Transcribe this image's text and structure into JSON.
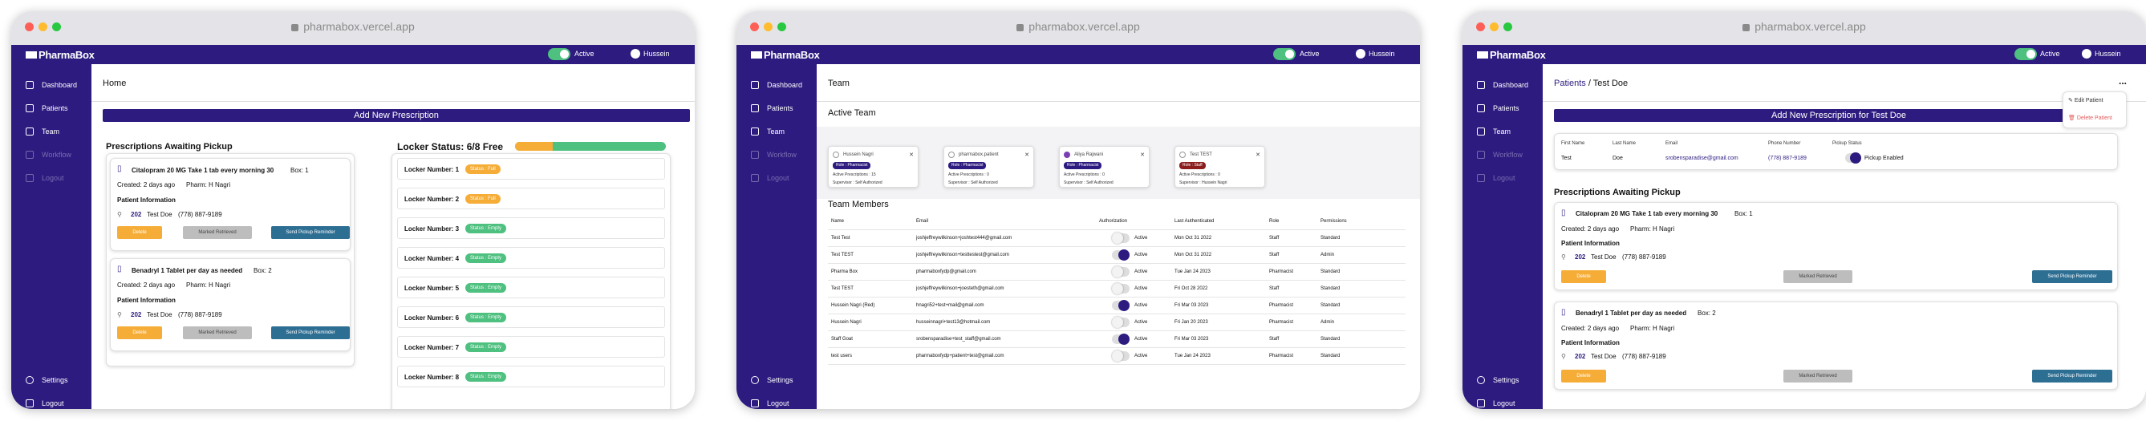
{
  "colors": {
    "brand": "#2d1b80",
    "active": "#4ec07f",
    "warning": "#f6ad37",
    "danger": "#e35d5d",
    "muted": "#bdbdbd",
    "teal": "#2d6e93"
  },
  "common": {
    "url": "pharmabox.vercel.app",
    "brand": "PharmaBox",
    "status_label": "Active",
    "user_name": "Hussein",
    "nav": {
      "dashboard": "Dashboard",
      "patients": "Patients",
      "team": "Team",
      "workflow": "Workflow",
      "logout": "Logout",
      "settings": "Settings"
    }
  },
  "home": {
    "breadcrumb": "Home",
    "add_button": "Add New Prescription",
    "awaiting_title": "Prescriptions Awaiting Pickup",
    "prescriptions": [
      {
        "med": "Citalopram 20 MG Take 1 tab every morning 30",
        "box": "Box: 1",
        "created": "Created: 2 days ago",
        "pharm": "Pharm: H Nagri",
        "info": "Patient Information",
        "room": "202",
        "patient": "Test Doe",
        "phone": "(778) 887-9189",
        "delete": "Delete",
        "retrieved": "Marked Retrieved",
        "reminder": "Send Pickup Reminder"
      },
      {
        "med": "Benadryl 1 Tablet per day as needed",
        "box": "Box: 2",
        "created": "Created: 2 days ago",
        "pharm": "Pharm: H Nagri",
        "info": "Patient Information",
        "room": "202",
        "patient": "Test Doe",
        "phone": "(778) 887-9189",
        "delete": "Delete",
        "retrieved": "Marked Retrieved",
        "reminder": "Send Pickup Reminder"
      }
    ],
    "locker_title": "Locker Status: 6/8 Free",
    "locker_fill": {
      "used": 0.25,
      "free": 0.75
    },
    "lockers": [
      {
        "label": "Locker Number: 1",
        "status": "Status : Full",
        "state": "full"
      },
      {
        "label": "Locker Number: 2",
        "status": "Status : Full",
        "state": "full"
      },
      {
        "label": "Locker Number: 3",
        "status": "Status : Empty",
        "state": "empty"
      },
      {
        "label": "Locker Number: 4",
        "status": "Status : Empty",
        "state": "empty"
      },
      {
        "label": "Locker Number: 5",
        "status": "Status : Empty",
        "state": "empty"
      },
      {
        "label": "Locker Number: 6",
        "status": "Status : Empty",
        "state": "empty"
      },
      {
        "label": "Locker Number: 7",
        "status": "Status : Empty",
        "state": "empty"
      },
      {
        "label": "Locker Number: 8",
        "status": "Status : Empty",
        "state": "empty"
      }
    ]
  },
  "team": {
    "breadcrumb": "Team",
    "active_title": "Active Team",
    "active": [
      {
        "name": "Hussein Nagri",
        "role": "Role : Pharmacist",
        "rx": "Active Prescriptions :  15",
        "sup": "Supervisor :  Self Authorized",
        "avatar": "outline"
      },
      {
        "name": "pharmabox.patient",
        "role": "Role : Pharmacist",
        "rx": "Active Prescriptions :  0",
        "sup": "Supervisor :  Self Authorized",
        "avatar": "outline"
      },
      {
        "name": "Aliya Rajwani",
        "role": "Role : Pharmacist",
        "rx": "Active Prescriptions :  0",
        "sup": "Supervisor :  Self Authorized",
        "avatar": "filled"
      },
      {
        "name": "Test TEST",
        "role": "Role : Staff",
        "rx": "Active Prescriptions :  0",
        "sup": "Supervisor :  Hussein Nagri",
        "avatar": "outline",
        "role_color": "#8b1d1d"
      }
    ],
    "members_title": "Team Members",
    "columns": [
      "Name",
      "Email",
      "Authorization",
      "Last Authenticated",
      "Role",
      "Permissions"
    ],
    "rows": [
      {
        "name": "Test Test",
        "email": "joshjeffreywilkinson+joshtest444@gmail.com",
        "auth": "Active",
        "on": false,
        "last": "Mon Oct 31 2022",
        "role": "Staff",
        "perm": "Standard"
      },
      {
        "name": "Test TEST",
        "email": "joshjeffreywilkinson+testtestest@gmail.com",
        "auth": "Active",
        "on": true,
        "last": "Mon Oct 31 2022",
        "role": "Staff",
        "perm": "Admin"
      },
      {
        "name": "Pharma Box",
        "email": "pharmaboxfydp@gmail.com",
        "auth": "Active",
        "on": false,
        "last": "Tue Jan 24 2023",
        "role": "Pharmacist",
        "perm": "Standard"
      },
      {
        "name": "Test TEST",
        "email": "joshjeffreywilkinson+joesteth@gmail.com",
        "auth": "Active",
        "on": false,
        "last": "Fri Oct 28 2022",
        "role": "Staff",
        "perm": "Standard"
      },
      {
        "name": "Hussein Nagri (Red)",
        "email": "hnagri52+test+mail@gmail.com",
        "auth": "Active",
        "on": true,
        "last": "Fri Mar 03 2023",
        "role": "Pharmacist",
        "perm": "Standard"
      },
      {
        "name": "Hussein Nagri",
        "email": "husseinnagri+test13@hotmail.com",
        "auth": "Active",
        "on": false,
        "last": "Fri Jan 20 2023",
        "role": "Pharmacist",
        "perm": "Admin"
      },
      {
        "name": "Staff Goat",
        "email": "srobensparadise+test_staff@gmail.com",
        "auth": "Active",
        "on": true,
        "last": "Fri Mar 03 2023",
        "role": "Staff",
        "perm": "Standard"
      },
      {
        "name": "test users",
        "email": "pharmaboxfydp+patient+test@gmail.com",
        "auth": "Active",
        "on": false,
        "last": "Tue Jan 24 2023",
        "role": "Pharmacist",
        "perm": "Standard"
      }
    ]
  },
  "patient": {
    "crumb_link": "Patients",
    "crumb_sep": "/",
    "crumb_current": "Test Doe",
    "more": "...",
    "menu_edit": "Edit Patient",
    "menu_delete": "Delete Patient",
    "add_button": "Add New Prescription for Test Doe",
    "fields": [
      {
        "label": "First Name",
        "value": "Test"
      },
      {
        "label": "Last Name",
        "value": "Doe"
      },
      {
        "label": "Email",
        "value": "srobensparadise@gmail.com"
      },
      {
        "label": "Phone Number",
        "value": "(778) 887-9189"
      },
      {
        "label": "Pickup Status",
        "value": "Pickup Enabled"
      }
    ],
    "awaiting_title": "Prescriptions Awaiting Pickup",
    "prescriptions": [
      {
        "med": "Citalopram 20 MG Take 1 tab every morning 30",
        "box": "Box: 1",
        "created": "Created: 2 days ago",
        "pharm": "Pharm: H Nagri",
        "info": "Patient Information",
        "room": "202",
        "patient": "Test Doe",
        "phone": "(778) 887-9189",
        "delete": "Delete",
        "retrieved": "Marked Retrieved",
        "reminder": "Send Pickup Reminder"
      },
      {
        "med": "Benadryl 1 Tablet per day as needed",
        "box": "Box: 2",
        "created": "Created: 2 days ago",
        "pharm": "Pharm: H Nagri",
        "info": "Patient Information",
        "room": "202",
        "patient": "Test Doe",
        "phone": "(778) 887-9189",
        "delete": "Delete",
        "retrieved": "Marked Retrieved",
        "reminder": "Send Pickup Reminder"
      }
    ]
  }
}
